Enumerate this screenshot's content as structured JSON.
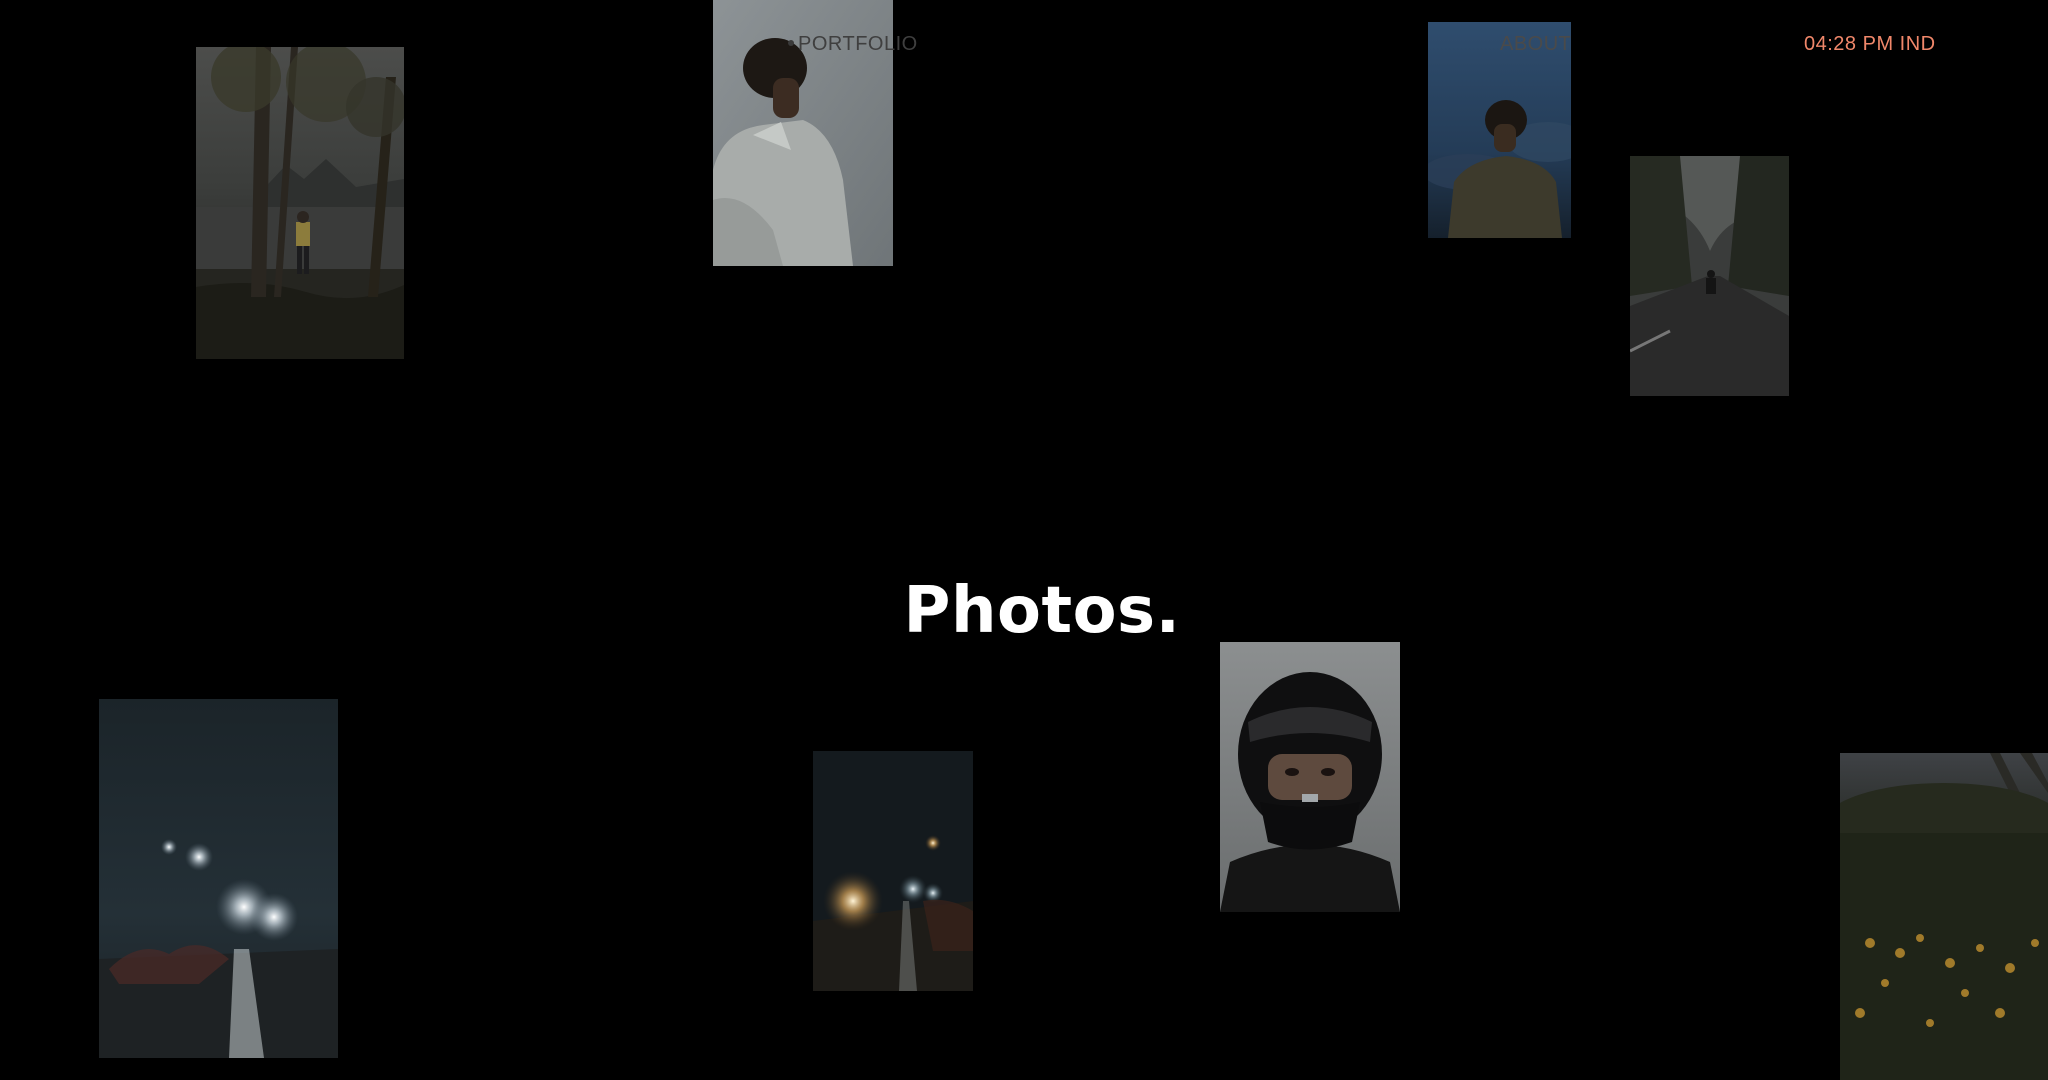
{
  "nav": {
    "portfolio_label": "PORTFOLIO",
    "about_label": "ABOUT",
    "time_text": "04:28 PM IND"
  },
  "hero": {
    "title": "Photos."
  },
  "colors": {
    "background": "#000000",
    "accent_time": "#f0876a",
    "nav_muted": "#3f3f3f",
    "title": "#ffffff"
  },
  "gallery": [
    "person-by-lake-photo",
    "man-profile-photo",
    "man-blue-hour-photo",
    "motorbike-road-photo",
    "foggy-headlights-photo",
    "night-lamps-photo",
    "helmet-portrait-photo",
    "flowers-field-photo"
  ]
}
